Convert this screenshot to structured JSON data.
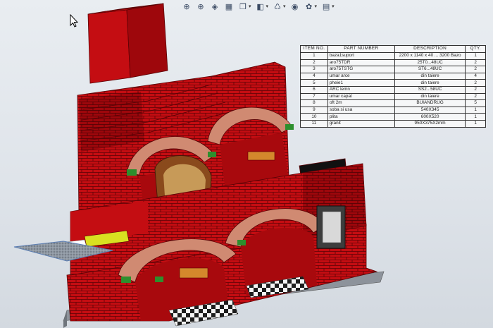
{
  "toolbar": {
    "buttons": [
      {
        "name": "zoom-to-fit-icon",
        "glyph": "⊕",
        "dropdown": false
      },
      {
        "name": "zoom-to-area-icon",
        "glyph": "⊕",
        "dropdown": false
      },
      {
        "name": "previous-view-icon",
        "glyph": "◈",
        "dropdown": false
      },
      {
        "name": "section-view-icon",
        "glyph": "▦",
        "dropdown": false
      },
      {
        "name": "view-orientation-icon",
        "glyph": "❒",
        "dropdown": true
      },
      {
        "name": "display-style-icon",
        "glyph": "◧",
        "dropdown": true
      },
      {
        "name": "hide-show-items-icon",
        "glyph": "♺",
        "dropdown": true
      },
      {
        "name": "edit-appearance-icon",
        "glyph": "◉",
        "dropdown": false
      },
      {
        "name": "apply-scene-icon",
        "glyph": "✿",
        "dropdown": true
      },
      {
        "name": "view-settings-icon",
        "glyph": "▤",
        "dropdown": true
      }
    ]
  },
  "bom": {
    "headers": [
      "ITEM NO.",
      "PART NUMBER",
      "DESCRIPTION",
      "QTY."
    ],
    "rows": [
      {
        "item": "1",
        "part": "baza1suport",
        "desc": "2200 x 1140 x 40 ... 3200 Bazo",
        "qty": "1"
      },
      {
        "item": "2",
        "part": "aro75TDR",
        "desc": "25T0...48UC",
        "qty": "2"
      },
      {
        "item": "3",
        "part": "aro75TSTG",
        "desc": "ST6...48UC",
        "qty": "2"
      },
      {
        "item": "4",
        "part": "umar arce",
        "desc": "din taiere",
        "qty": "4"
      },
      {
        "item": "5",
        "part": "pheie1",
        "desc": "din taiere",
        "qty": "2"
      },
      {
        "item": "6",
        "part": "ARC lemn",
        "desc": "SS2...58UC",
        "qty": "2"
      },
      {
        "item": "7",
        "part": "umar capat",
        "desc": "din taiere",
        "qty": "2"
      },
      {
        "item": "8",
        "part": "oft 2m",
        "desc": "BUIANDRUG",
        "qty": "5"
      },
      {
        "item": "9",
        "part": "soba si usa",
        "desc": "540X345",
        "qty": "1"
      },
      {
        "item": "10",
        "part": "plita",
        "desc": "600X520",
        "qty": "1"
      },
      {
        "item": "11",
        "part": "granit",
        "desc": "950X375X2mm",
        "qty": "1"
      }
    ]
  },
  "colors": {
    "brick": "#c40d12",
    "brick_dark": "#7e0308",
    "brick_mid": "#a8090d",
    "mortar": "#5a0205",
    "arch_brick": "#d08a72",
    "arch_wood": "#8a4a1c",
    "granite": "#8e97a2",
    "stone_green": "#2d8f2d",
    "yellow_plate": "#d9e021",
    "tile_dark": "#222222",
    "tile_light": "#f4f4f4",
    "base_gray": "#8d939b"
  }
}
